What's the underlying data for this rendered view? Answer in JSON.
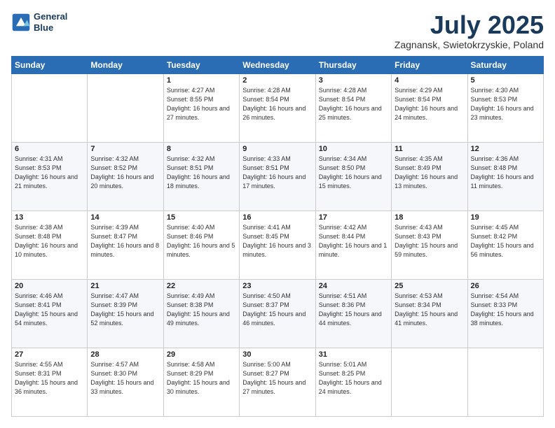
{
  "header": {
    "logo_line1": "General",
    "logo_line2": "Blue",
    "month_title": "July 2025",
    "location": "Zagnansk, Swietokrzyskie, Poland"
  },
  "days_of_week": [
    "Sunday",
    "Monday",
    "Tuesday",
    "Wednesday",
    "Thursday",
    "Friday",
    "Saturday"
  ],
  "weeks": [
    [
      {
        "day": null,
        "info": null
      },
      {
        "day": null,
        "info": null
      },
      {
        "day": "1",
        "info": "Sunrise: 4:27 AM\nSunset: 8:55 PM\nDaylight: 16 hours\nand 27 minutes."
      },
      {
        "day": "2",
        "info": "Sunrise: 4:28 AM\nSunset: 8:54 PM\nDaylight: 16 hours\nand 26 minutes."
      },
      {
        "day": "3",
        "info": "Sunrise: 4:28 AM\nSunset: 8:54 PM\nDaylight: 16 hours\nand 25 minutes."
      },
      {
        "day": "4",
        "info": "Sunrise: 4:29 AM\nSunset: 8:54 PM\nDaylight: 16 hours\nand 24 minutes."
      },
      {
        "day": "5",
        "info": "Sunrise: 4:30 AM\nSunset: 8:53 PM\nDaylight: 16 hours\nand 23 minutes."
      }
    ],
    [
      {
        "day": "6",
        "info": "Sunrise: 4:31 AM\nSunset: 8:53 PM\nDaylight: 16 hours\nand 21 minutes."
      },
      {
        "day": "7",
        "info": "Sunrise: 4:32 AM\nSunset: 8:52 PM\nDaylight: 16 hours\nand 20 minutes."
      },
      {
        "day": "8",
        "info": "Sunrise: 4:32 AM\nSunset: 8:51 PM\nDaylight: 16 hours\nand 18 minutes."
      },
      {
        "day": "9",
        "info": "Sunrise: 4:33 AM\nSunset: 8:51 PM\nDaylight: 16 hours\nand 17 minutes."
      },
      {
        "day": "10",
        "info": "Sunrise: 4:34 AM\nSunset: 8:50 PM\nDaylight: 16 hours\nand 15 minutes."
      },
      {
        "day": "11",
        "info": "Sunrise: 4:35 AM\nSunset: 8:49 PM\nDaylight: 16 hours\nand 13 minutes."
      },
      {
        "day": "12",
        "info": "Sunrise: 4:36 AM\nSunset: 8:48 PM\nDaylight: 16 hours\nand 11 minutes."
      }
    ],
    [
      {
        "day": "13",
        "info": "Sunrise: 4:38 AM\nSunset: 8:48 PM\nDaylight: 16 hours\nand 10 minutes."
      },
      {
        "day": "14",
        "info": "Sunrise: 4:39 AM\nSunset: 8:47 PM\nDaylight: 16 hours\nand 8 minutes."
      },
      {
        "day": "15",
        "info": "Sunrise: 4:40 AM\nSunset: 8:46 PM\nDaylight: 16 hours\nand 5 minutes."
      },
      {
        "day": "16",
        "info": "Sunrise: 4:41 AM\nSunset: 8:45 PM\nDaylight: 16 hours\nand 3 minutes."
      },
      {
        "day": "17",
        "info": "Sunrise: 4:42 AM\nSunset: 8:44 PM\nDaylight: 16 hours\nand 1 minute."
      },
      {
        "day": "18",
        "info": "Sunrise: 4:43 AM\nSunset: 8:43 PM\nDaylight: 15 hours\nand 59 minutes."
      },
      {
        "day": "19",
        "info": "Sunrise: 4:45 AM\nSunset: 8:42 PM\nDaylight: 15 hours\nand 56 minutes."
      }
    ],
    [
      {
        "day": "20",
        "info": "Sunrise: 4:46 AM\nSunset: 8:41 PM\nDaylight: 15 hours\nand 54 minutes."
      },
      {
        "day": "21",
        "info": "Sunrise: 4:47 AM\nSunset: 8:39 PM\nDaylight: 15 hours\nand 52 minutes."
      },
      {
        "day": "22",
        "info": "Sunrise: 4:49 AM\nSunset: 8:38 PM\nDaylight: 15 hours\nand 49 minutes."
      },
      {
        "day": "23",
        "info": "Sunrise: 4:50 AM\nSunset: 8:37 PM\nDaylight: 15 hours\nand 46 minutes."
      },
      {
        "day": "24",
        "info": "Sunrise: 4:51 AM\nSunset: 8:36 PM\nDaylight: 15 hours\nand 44 minutes."
      },
      {
        "day": "25",
        "info": "Sunrise: 4:53 AM\nSunset: 8:34 PM\nDaylight: 15 hours\nand 41 minutes."
      },
      {
        "day": "26",
        "info": "Sunrise: 4:54 AM\nSunset: 8:33 PM\nDaylight: 15 hours\nand 38 minutes."
      }
    ],
    [
      {
        "day": "27",
        "info": "Sunrise: 4:55 AM\nSunset: 8:31 PM\nDaylight: 15 hours\nand 36 minutes."
      },
      {
        "day": "28",
        "info": "Sunrise: 4:57 AM\nSunset: 8:30 PM\nDaylight: 15 hours\nand 33 minutes."
      },
      {
        "day": "29",
        "info": "Sunrise: 4:58 AM\nSunset: 8:29 PM\nDaylight: 15 hours\nand 30 minutes."
      },
      {
        "day": "30",
        "info": "Sunrise: 5:00 AM\nSunset: 8:27 PM\nDaylight: 15 hours\nand 27 minutes."
      },
      {
        "day": "31",
        "info": "Sunrise: 5:01 AM\nSunset: 8:25 PM\nDaylight: 15 hours\nand 24 minutes."
      },
      {
        "day": null,
        "info": null
      },
      {
        "day": null,
        "info": null
      }
    ]
  ]
}
